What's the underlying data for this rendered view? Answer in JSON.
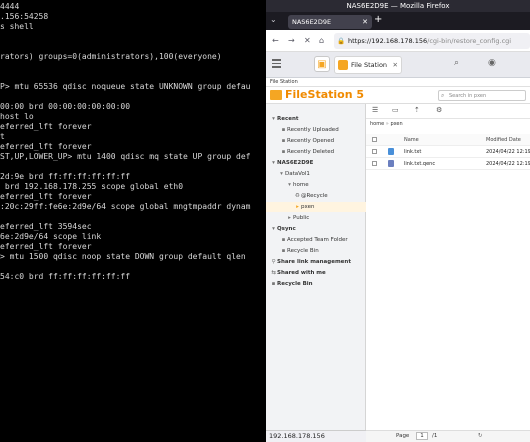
{
  "terminal": {
    "lines": [
      "4444",
      ".156:54258",
      "s shell",
      "",
      "",
      "rators) groups=0(administrators),100(everyone)",
      "",
      "",
      "P> mtu 65536 qdisc noqueue state UNKNOWN group defau",
      "",
      "00:00 brd 00:00:00:00:00:00",
      "host lo",
      "eferred_lft forever",
      "t",
      "eferred_lft forever",
      "ST,UP,LOWER_UP> mtu 1400 qdisc mq state UP group def",
      "",
      "2d:9e brd ff:ff:ff:ff:ff:ff",
      " brd 192.168.178.255 scope global eth0",
      "eferred_lft forever",
      ":20c:29ff:fe6e:2d9e/64 scope global mngtmpaddr dynam",
      "",
      "eferred_lft 3594sec",
      "6e:2d9e/64 scope link",
      "eferred_lft forever",
      "> mtu 1500 qdisc noop state DOWN group default qlen",
      "",
      "54:c0 brd ff:ff:ff:ff:ff:ff"
    ]
  },
  "browser": {
    "window_title": "NAS6E2D9E — Mozilla Firefox",
    "tab_title": "NAS6E2D9E",
    "url_host": "https://192.168.178.156",
    "url_path": "/cgi-bin/restore_config.cgi",
    "status_url": "192.168.178.156"
  },
  "qts": {
    "app_tab_label": "File Station"
  },
  "filestation": {
    "strip_label": "File Station",
    "title": "FileStation 5",
    "search_placeholder": "Search in pxen",
    "sidebar": {
      "recent": "Recent",
      "recently_uploaded": "Recently Uploaded",
      "recently_opened": "Recently Opened",
      "recently_deleted": "Recently Deleted",
      "nas": "NAS6E2D9E",
      "datavol": "DataVol1",
      "home": "home",
      "recycle_folder": "@Recycle",
      "pxen": "pxen",
      "public": "Public",
      "qsync": "Qsync",
      "accepted_team": "Accepted Team Folder",
      "qsync_recycle": "Recycle Bin",
      "share_link": "Share link management",
      "shared_with_me": "Shared with me",
      "recycle_bin": "Recycle Bin"
    },
    "breadcrumb": [
      "home",
      "pxen"
    ],
    "table": {
      "headers": {
        "name": "Name",
        "modified": "Modified Date"
      },
      "rows": [
        {
          "name": "link.txt",
          "date": "2024/04/22 12:19"
        },
        {
          "name": "link.txt.qenc",
          "date": "2024/04/22 12:19"
        }
      ]
    },
    "footer": {
      "page_label": "Page",
      "page_value": "1",
      "total": "/1"
    }
  }
}
